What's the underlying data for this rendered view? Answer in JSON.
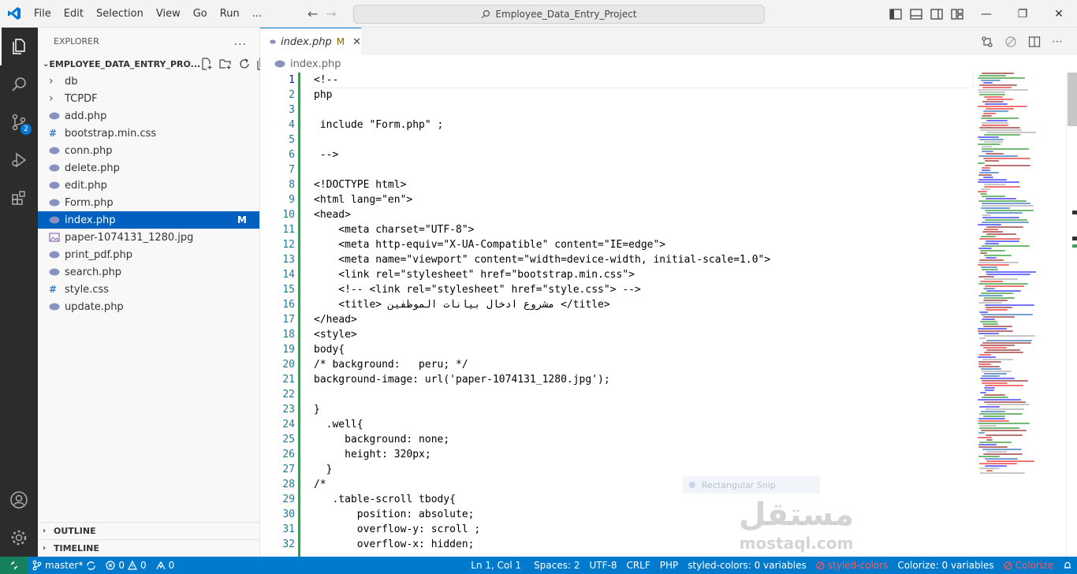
{
  "titlebar": {
    "menus": [
      "File",
      "Edit",
      "Selection",
      "View",
      "Go",
      "Run",
      "..."
    ],
    "search_text": "Employee_Data_Entry_Project"
  },
  "explorer": {
    "title": "EXPLORER",
    "more": "...",
    "project": "EMPLOYEE_DATA_ENTRY_PRO...",
    "items": [
      {
        "label": "db",
        "type": "folder"
      },
      {
        "label": "TCPDF",
        "type": "folder"
      },
      {
        "label": "add.php",
        "type": "php"
      },
      {
        "label": "bootstrap.min.css",
        "type": "css"
      },
      {
        "label": "conn.php",
        "type": "php"
      },
      {
        "label": "delete.php",
        "type": "php"
      },
      {
        "label": "edit.php",
        "type": "php"
      },
      {
        "label": "Form.php",
        "type": "php"
      },
      {
        "label": "index.php",
        "type": "php",
        "selected": true,
        "status": "M"
      },
      {
        "label": "paper-1074131_1280.jpg",
        "type": "image"
      },
      {
        "label": "print_pdf.php",
        "type": "php"
      },
      {
        "label": "search.php",
        "type": "php"
      },
      {
        "label": "style.css",
        "type": "css"
      },
      {
        "label": "update.php",
        "type": "php"
      }
    ],
    "outline": "OUTLINE",
    "timeline": "TIMELINE"
  },
  "activity": {
    "scm_badge": "2"
  },
  "editor": {
    "tab_label": "index.php",
    "tab_status": "M",
    "breadcrumb": "index.php",
    "line_numbers": [
      "1",
      "2",
      "3",
      "4",
      "5",
      "6",
      "7",
      "8",
      "9",
      "10",
      "11",
      "12",
      "13",
      "14",
      "15",
      "16",
      "17",
      "18",
      "19",
      "20",
      "21",
      "22",
      "23",
      "24",
      "25",
      "26",
      "27",
      "28",
      "29",
      "30",
      "31",
      "32"
    ],
    "lines": [
      "<!--",
      "php",
      "",
      " include \"Form.php\" ;",
      "",
      " -->",
      "",
      "<!DOCTYPE html>",
      "<html lang=\"en\">",
      "<head>",
      "    <meta charset=\"UTF-8\">",
      "    <meta http-equiv=\"X-UA-Compatible\" content=\"IE=edge\">",
      "    <meta name=\"viewport\" content=\"width=device-width, initial-scale=1.0\">",
      "    <link rel=\"stylesheet\" href=\"bootstrap.min.css\">",
      "    <!-- <link rel=\"stylesheet\" href=\"style.css\"> -->",
      "    <title> مشروع ادخال بيانات الموظفين </title>",
      "</head>",
      "<style>",
      "body{",
      "/* background:   peru; */",
      "background-image: url('paper-1074131_1280.jpg');",
      "",
      "}",
      "  .well{",
      "     background: none;",
      "     height: 320px;",
      "  }",
      "/*",
      "   .table-scroll tbody{",
      "       position: absolute;",
      "       overflow-y: scroll ;",
      "       overflow-x: hidden;"
    ],
    "snip_text": "Rectangular Snip",
    "watermark_ar": "مستقل",
    "watermark_en": "mostaql.com"
  },
  "status": {
    "branch": "master*",
    "errors": "0",
    "warnings": "0",
    "ports": "0",
    "position": "Ln 1, Col 1",
    "spaces": "Spaces: 2",
    "encoding": "UTF-8",
    "eol": "CRLF",
    "language": "PHP",
    "styled_vars": "styled-colors: 0 variables",
    "styled_colors": "styled-colors",
    "colorize_vars": "Colorize: 0 variables",
    "colorize": "Colorize"
  }
}
